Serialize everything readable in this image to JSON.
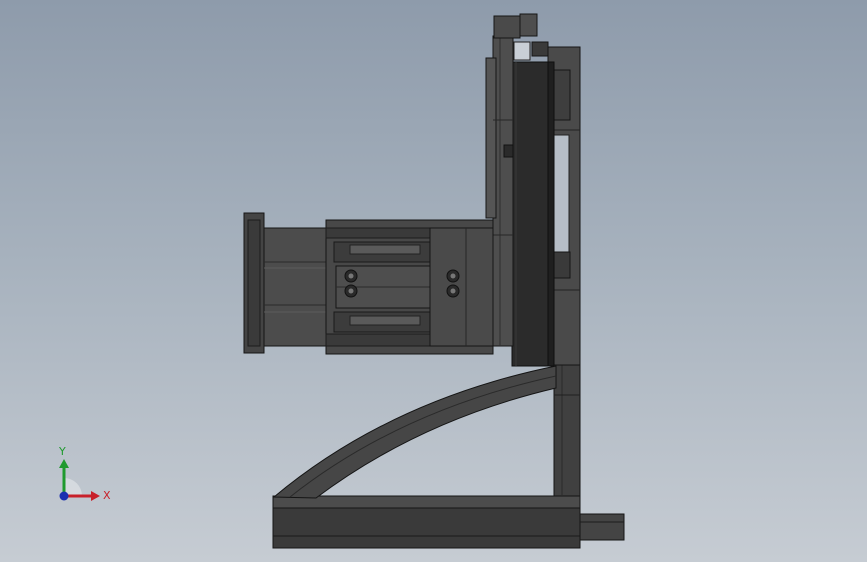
{
  "view": {
    "background_top": "#8e9bab",
    "background_bottom": "#c6ccd3",
    "part_color": "#3d3d3d"
  },
  "triad": {
    "x_label": "X",
    "y_label": "Y",
    "x_color": "#c8202a",
    "y_color": "#1f9a2e",
    "z_color": "#1a2fb0"
  }
}
